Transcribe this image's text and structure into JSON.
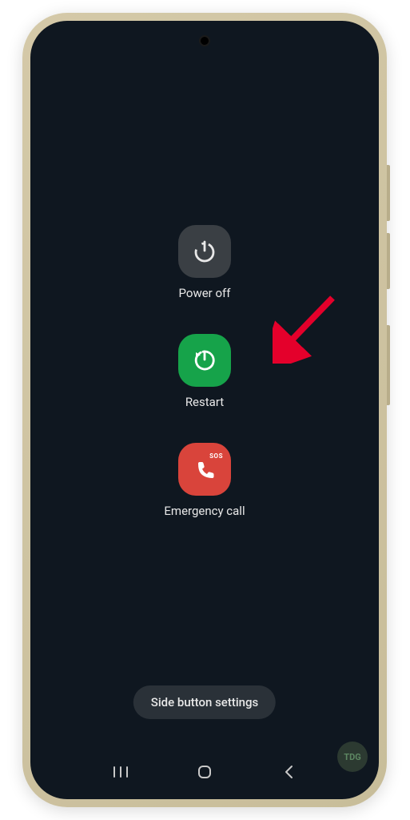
{
  "menu": {
    "power_off": {
      "label": "Power off"
    },
    "restart": {
      "label": "Restart"
    },
    "emergency": {
      "label": "Emergency call",
      "badge": "SOS"
    }
  },
  "settings_button": {
    "label": "Side button settings"
  },
  "watermark": {
    "text": "TDG"
  },
  "colors": {
    "screen_bg": "#0f1720",
    "tile_gray": "#3a3f44",
    "tile_green": "#16a34a",
    "tile_red": "#d9443b",
    "arrow": "#e4002b"
  }
}
